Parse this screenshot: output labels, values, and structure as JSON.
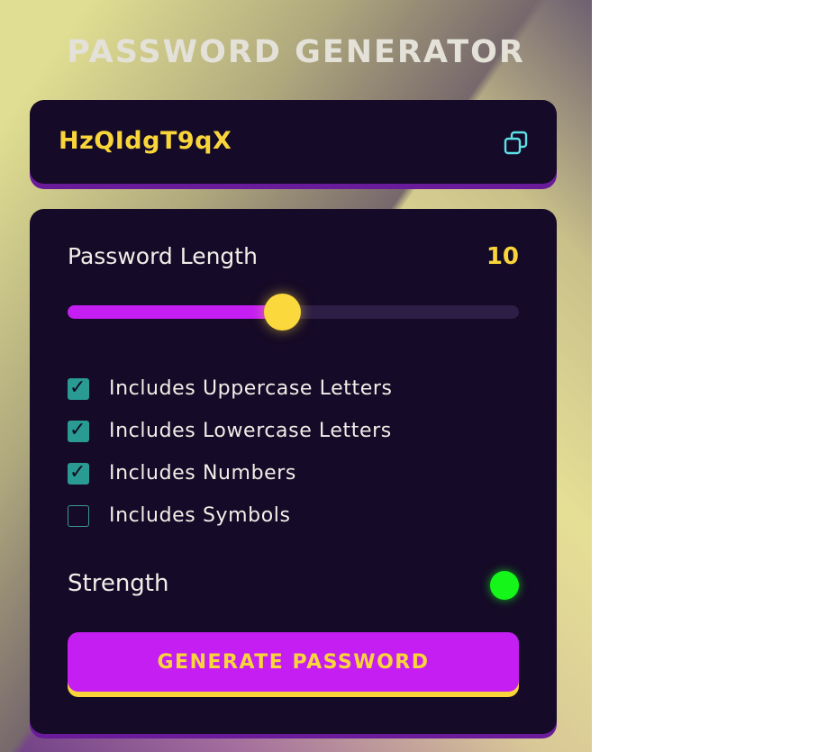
{
  "app": {
    "title": "PASSWORD GENERATOR"
  },
  "output": {
    "password": "HzQIdgT9qX",
    "copy_icon": "copy-icon"
  },
  "length": {
    "label": "Password Length",
    "value": "10",
    "slider_fraction": 0.475
  },
  "options": [
    {
      "label": "Includes Uppercase Letters",
      "checked": true
    },
    {
      "label": "Includes Lowercase Letters",
      "checked": true
    },
    {
      "label": "Includes Numbers",
      "checked": true
    },
    {
      "label": "Includes Symbols",
      "checked": false
    }
  ],
  "strength": {
    "label": "Strength",
    "indicator_color": "#16f51a"
  },
  "generate_button": {
    "label": "GENERATE PASSWORD"
  },
  "colors": {
    "card_bg": "#150a27",
    "accent_yellow": "#f9d53a",
    "accent_purple": "#c41ef2",
    "checkbox_teal": "#2a9b93",
    "copy_icon_cyan": "#5ce1e6"
  }
}
